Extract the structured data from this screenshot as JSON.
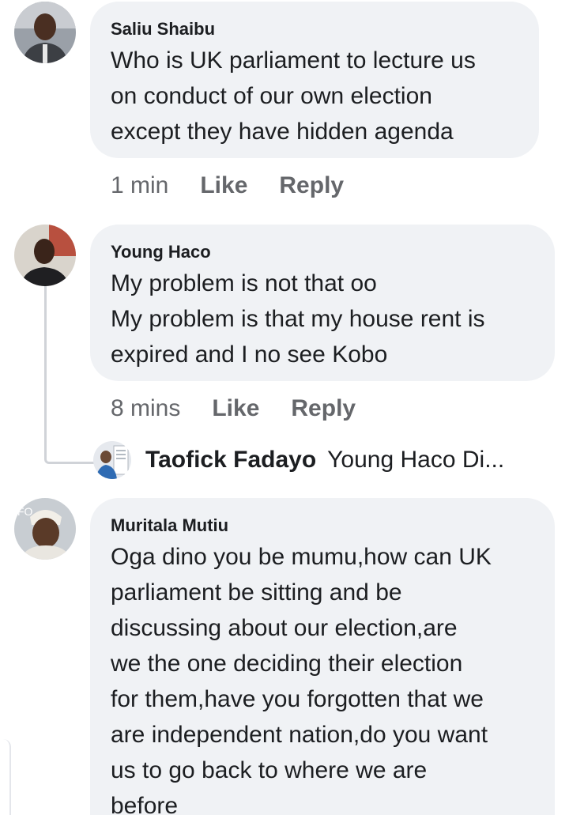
{
  "comments": [
    {
      "author": "Saliu Shaibu",
      "avatar_icon": "profile-photo-man-icon",
      "lines": [
        "Who is UK parliament to lecture us",
        "on conduct of our own election",
        "except they have hidden agenda"
      ],
      "time": "1 min",
      "like_label": "Like",
      "reply_label": "Reply"
    },
    {
      "author": "Young Haco",
      "avatar_icon": "profile-photo-man-icon",
      "lines": [
        "My problem is not that oo",
        "My problem is that my house rent is",
        "expired and I no see Kobo"
      ],
      "time": "8 mins",
      "like_label": "Like",
      "reply_label": "Reply",
      "reply_preview": {
        "author": "Taofick Fadayo",
        "text": "Young Haco Di...",
        "avatar_icon": "profile-photo-icon"
      }
    },
    {
      "author": "Muritala Mutiu",
      "avatar_icon": "profile-photo-man-cap-icon",
      "lines": [
        "Oga dino you be mumu,how can UK",
        "parliament be sitting and be",
        "discussing about our election,are",
        "we the one deciding their election",
        "for them,have you forgotten that we",
        "are independent nation,do you want",
        "us to go back to where we are",
        "before"
      ]
    }
  ],
  "colors": {
    "bubble_bg": "#f0f2f5",
    "text": "#1c1e21",
    "meta_text": "#65676b",
    "thread_line": "#d0d3d8"
  }
}
